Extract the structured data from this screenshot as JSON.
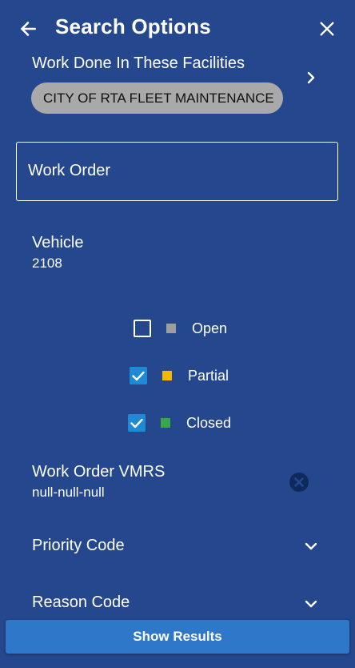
{
  "header": {
    "title": "Search Options"
  },
  "facilities": {
    "label": "Work Done In These Facilities",
    "chip": "CITY OF RTA FLEET MAINTENANCE"
  },
  "work_order": {
    "label": "Work Order"
  },
  "vehicle": {
    "label": "Vehicle",
    "value": "2108"
  },
  "statuses": [
    {
      "label": "Open",
      "checked": false,
      "color": "#9e9e9e"
    },
    {
      "label": "Partial",
      "checked": true,
      "color": "#f5b800"
    },
    {
      "label": "Closed",
      "checked": true,
      "color": "#3aa64a"
    }
  ],
  "vmrs": {
    "label": "Work Order VMRS",
    "value": "null-null-null"
  },
  "priority": {
    "label": "Priority Code"
  },
  "reason": {
    "label": "Reason Code"
  },
  "actions": {
    "show_results": "Show Results"
  },
  "colors": {
    "background": "#24478e",
    "accent": "#2f77c8",
    "checkbox": "#1e8ad6"
  }
}
